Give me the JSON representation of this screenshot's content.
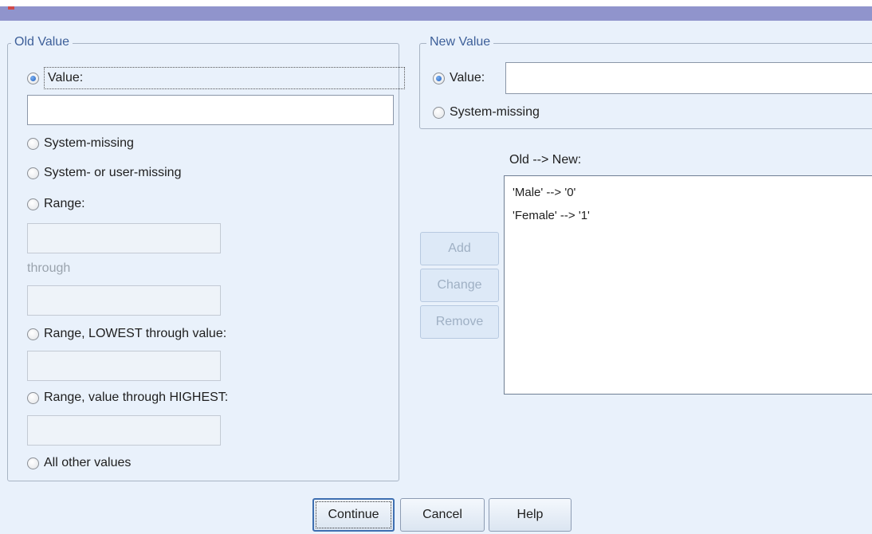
{
  "old_value": {
    "legend": "Old Value",
    "value_radio": {
      "label": "Value:",
      "checked": true
    },
    "value_input": "",
    "system_missing": "System-missing",
    "system_or_user_missing": "System- or user-missing",
    "range": "Range:",
    "range_from": "",
    "through": "through",
    "range_to": "",
    "range_lowest": "Range, LOWEST through value:",
    "range_lowest_input": "",
    "range_highest": "Range, value through HIGHEST:",
    "range_highest_input": "",
    "all_other": "All other values"
  },
  "new_value": {
    "legend": "New Value",
    "value_radio": {
      "label": "Value:",
      "checked": true
    },
    "value_input": "",
    "system_missing": "System-missing"
  },
  "mapping": {
    "label": "Old --> New:",
    "items": [
      "'Male' --> '0'",
      "'Female' --> '1'"
    ]
  },
  "buttons": {
    "add": "Add",
    "change": "Change",
    "remove": "Remove"
  },
  "footer": {
    "continue": "Continue",
    "cancel": "Cancel",
    "help": "Help"
  }
}
